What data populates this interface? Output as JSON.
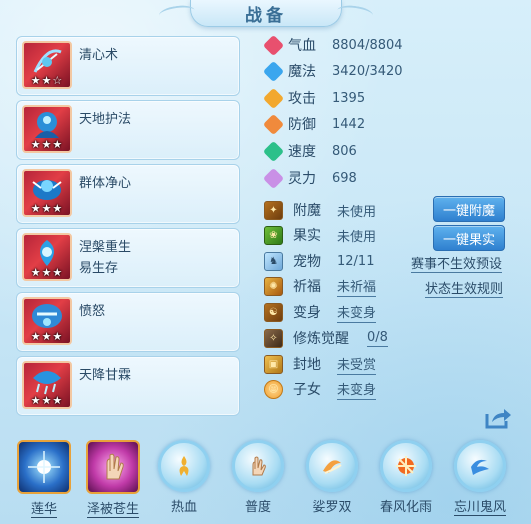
{
  "title": "战备",
  "skills": [
    {
      "names": [
        "清心术"
      ],
      "stars": "★★☆"
    },
    {
      "names": [
        "天地护法"
      ],
      "stars": "★★★"
    },
    {
      "names": [
        "群体净心"
      ],
      "stars": "★★★"
    },
    {
      "names": [
        "涅槃重生",
        "易生存"
      ],
      "stars": "★★★"
    },
    {
      "names": [
        "愤怒"
      ],
      "stars": "★★★"
    },
    {
      "names": [
        "天降甘霖"
      ],
      "stars": "★★★"
    }
  ],
  "stats": [
    {
      "label": "气血",
      "value": "8804/8804",
      "color": "#e8506e"
    },
    {
      "label": "魔法",
      "value": "3420/3420",
      "color": "#3aa6ee"
    },
    {
      "label": "攻击",
      "value": "1395",
      "color": "#f2a82e"
    },
    {
      "label": "防御",
      "value": "1442",
      "color": "#f08a3c"
    },
    {
      "label": "速度",
      "value": "806",
      "color": "#2cc08a"
    },
    {
      "label": "灵力",
      "value": "698",
      "color": "#c990e6"
    }
  ],
  "items": {
    "enchant": {
      "label": "附魔",
      "value": "未使用",
      "icon": "enchant-icon",
      "glyph": "✦"
    },
    "fruit": {
      "label": "果实",
      "value": "未使用",
      "icon": "fruit-icon",
      "glyph": "❀"
    },
    "pet": {
      "label": "宠物",
      "value": "12/11",
      "icon": "pet-icon",
      "glyph": "♞"
    },
    "blessing": {
      "label": "祈福",
      "value": "未祈福",
      "icon": "blessing-icon",
      "glyph": "✺"
    },
    "transform": {
      "label": "变身",
      "value": "未变身",
      "icon": "transform-icon",
      "glyph": "☯"
    },
    "cultivation": {
      "label": "修炼觉醒",
      "value": "0/8",
      "icon": "cultivation-icon",
      "glyph": "✧"
    },
    "title_seal": {
      "label": "封地",
      "value": "未受赏",
      "icon": "seal-icon",
      "glyph": "▣"
    },
    "child": {
      "label": "子女",
      "value": "未变身",
      "icon": "child-icon",
      "glyph": "☺"
    }
  },
  "buttons": {
    "one_click_enchant": "一键附魔",
    "one_click_fruit": "一键果实",
    "event_preset": "赛事不生效预设",
    "status_rules": "状态生效规则"
  },
  "formations": [
    {
      "label": "莲华",
      "underline": true
    },
    {
      "label": "泽被苍生",
      "underline": true
    },
    {
      "label": "热血",
      "underline": false
    },
    {
      "label": "普度",
      "underline": false
    },
    {
      "label": "娑罗双",
      "underline": false
    },
    {
      "label": "春风化雨",
      "underline": false
    },
    {
      "label": "忘川鬼风",
      "underline": true
    }
  ]
}
